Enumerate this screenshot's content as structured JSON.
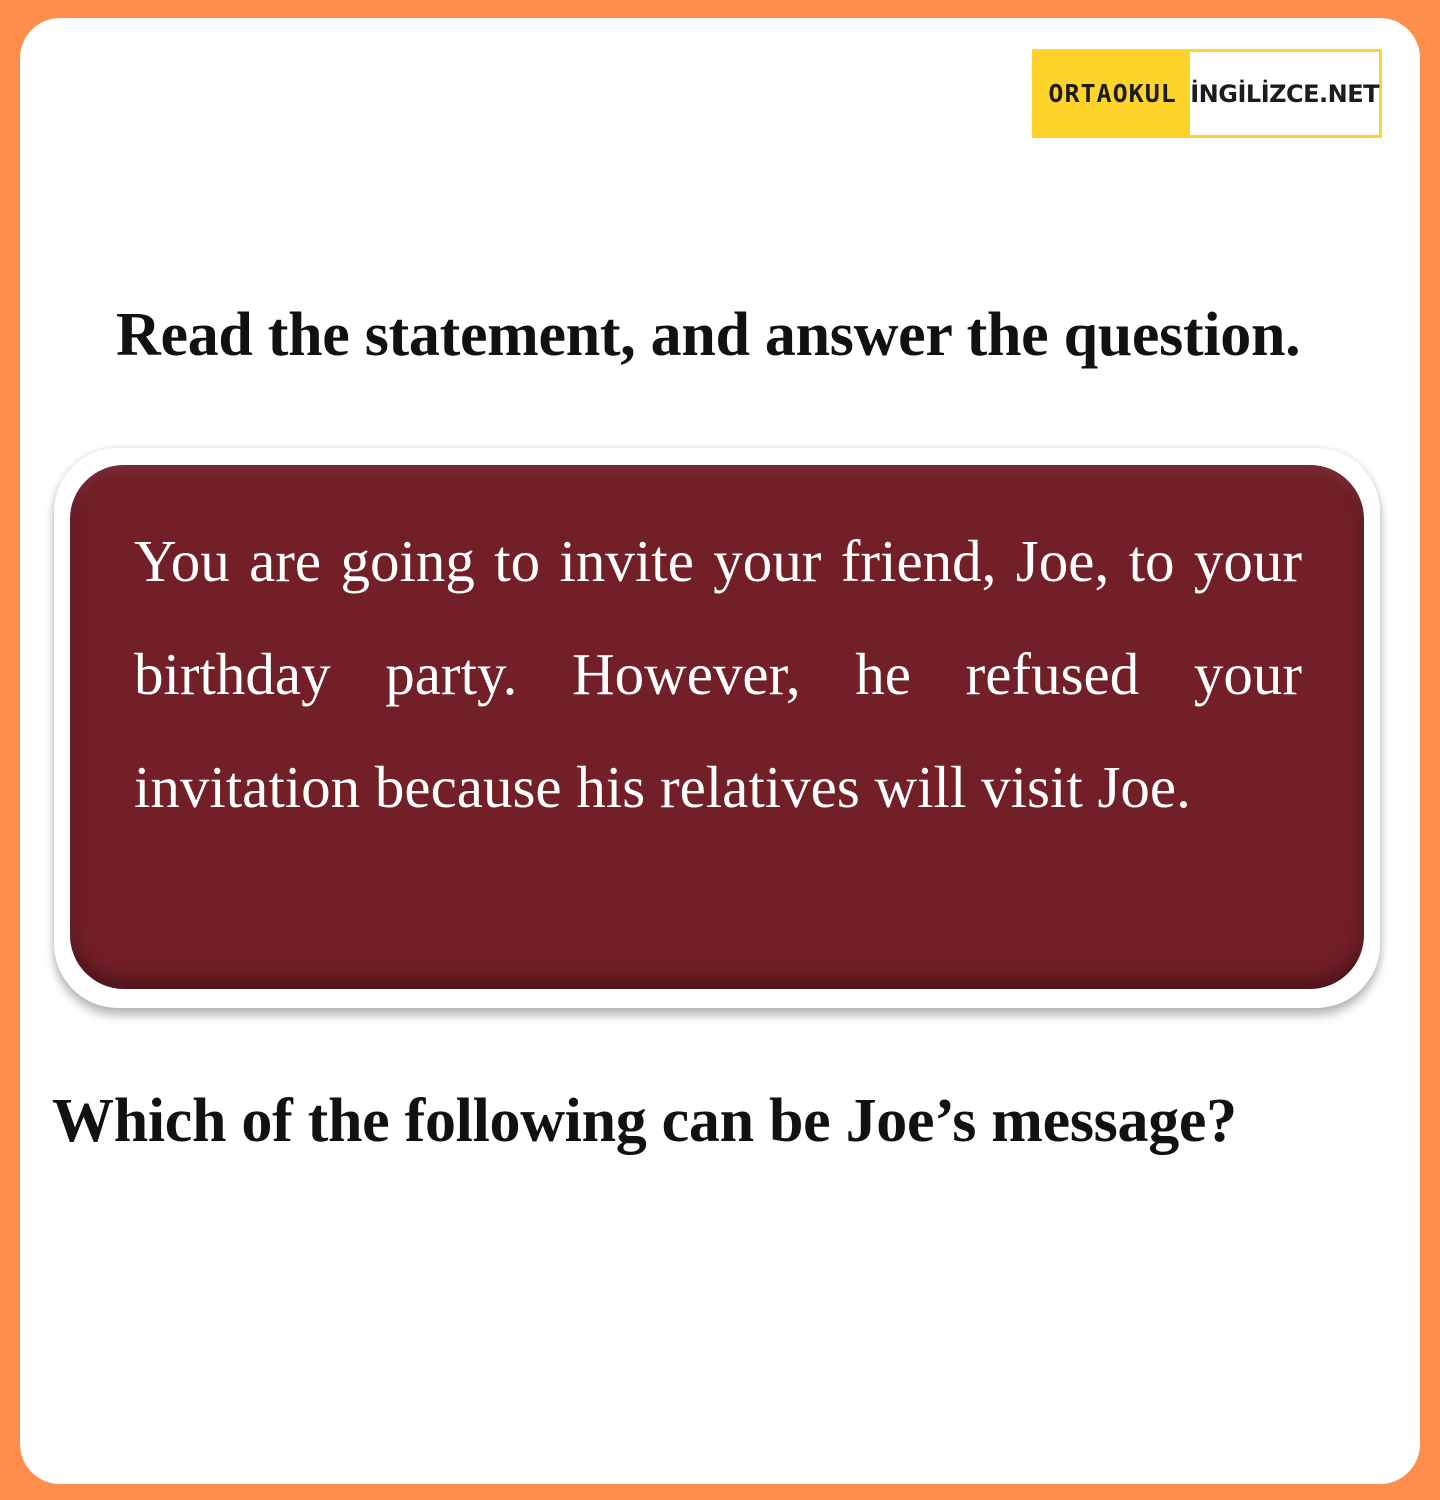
{
  "logo": {
    "part1": "ORTAOKUL",
    "part2": "İNGİLİZCE.NET"
  },
  "instruction": "Read the statement, and answer the question.",
  "statement": "You are going to invite your friend, Joe, to your birthday party. However, he refused your invitation because his relatives will visit Joe.",
  "question": "Which of the following can be Joe’s message?",
  "colors": {
    "frame": "#FF8E4C",
    "logo_yellow": "#FFD42A",
    "statement_bg": "#731F27"
  }
}
